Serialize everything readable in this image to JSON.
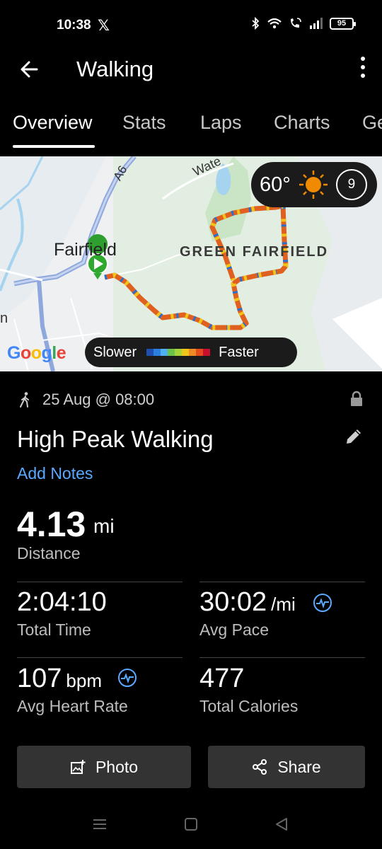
{
  "status_bar": {
    "time": "10:38",
    "notification": "𝕏",
    "battery": "95"
  },
  "header": {
    "title": "Walking"
  },
  "tabs": [
    {
      "label": "Overview",
      "active": true
    },
    {
      "label": "Stats",
      "active": false
    },
    {
      "label": "Laps",
      "active": false
    },
    {
      "label": "Charts",
      "active": false
    },
    {
      "label": "Ge",
      "active": false
    }
  ],
  "map": {
    "labels": {
      "town": "Fairfield",
      "area": "GREEN FAIRFIELD",
      "road": "A6",
      "water": "Wate",
      "edge": "n"
    },
    "attribution": "Google",
    "weather": {
      "temp": "60°",
      "wind": "9"
    },
    "legend": {
      "slower": "Slower",
      "faster": "Faster",
      "colors": [
        "#1f4fb0",
        "#2b7fe0",
        "#4fb0f0",
        "#6cc24a",
        "#a6d23a",
        "#f0c419",
        "#f08a24",
        "#e64b1e",
        "#c8102e"
      ]
    }
  },
  "activity": {
    "date": "25 Aug @ 08:00",
    "name": "High Peak Walking",
    "add_notes": "Add Notes"
  },
  "stats": {
    "distance": {
      "value": "4.13",
      "unit": "mi",
      "label": "Distance"
    },
    "total_time": {
      "value": "2:04:10",
      "label": "Total Time"
    },
    "avg_pace": {
      "value": "30:02",
      "unit": "/mi",
      "label": "Avg Pace"
    },
    "avg_hr": {
      "value": "107",
      "unit": "bpm",
      "label": "Avg Heart Rate"
    },
    "calories": {
      "value": "477",
      "label": "Total Calories"
    }
  },
  "actions": {
    "photo": "Photo",
    "share": "Share"
  },
  "icons": {
    "back": "arrow-left-icon",
    "more": "more-vertical-icon",
    "sun": "sun-icon",
    "wind": "wind-icon",
    "walker": "walking-person-icon",
    "lock": "lock-icon",
    "edit": "pencil-icon",
    "hr": "heart-rate-icon",
    "photo": "add-photo-icon",
    "share": "share-icon"
  }
}
